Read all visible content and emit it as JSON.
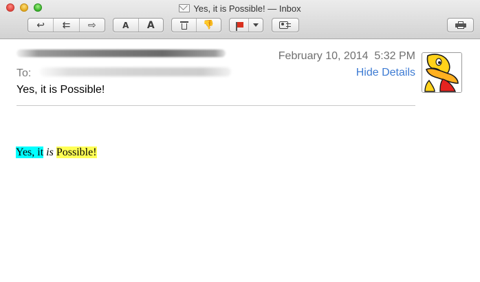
{
  "window": {
    "title": "Yes, it is Possible! — Inbox",
    "title_icon": "envelope-icon"
  },
  "toolbar": {
    "groups": [
      {
        "name": "reply-group",
        "buttons": [
          {
            "name": "reply-button",
            "icon": "reply-icon",
            "glyph": "↩"
          },
          {
            "name": "reply-all-button",
            "icon": "reply-all-icon",
            "glyph": "⇇"
          },
          {
            "name": "forward-button",
            "icon": "forward-icon",
            "glyph": "⇨"
          }
        ]
      },
      {
        "name": "font-size-group",
        "buttons": [
          {
            "name": "smaller-font-button",
            "label": "A"
          },
          {
            "name": "larger-font-button",
            "label": "A"
          }
        ]
      },
      {
        "name": "delete-junk-group",
        "buttons": [
          {
            "name": "delete-button",
            "icon": "trash-icon"
          },
          {
            "name": "junk-button",
            "icon": "thumbs-down-icon",
            "glyph": "👎"
          }
        ]
      }
    ],
    "flag": {
      "icon": "flag-icon",
      "color": "#d9301e"
    },
    "contact_icon": "add-contact-icon",
    "print_icon": "printer-icon"
  },
  "header": {
    "to_label": "To:",
    "subject": "Yes, it is Possible!",
    "date": "February 10, 2014  5:32 PM",
    "hide_details": "Hide Details",
    "link_color": "#3d7bd3"
  },
  "body": {
    "part1": "Yes, it",
    "part2": " ",
    "part3": "is",
    "part4": " ",
    "part5": "Possible!",
    "highlight_colors": {
      "cyan": "#00ffff",
      "yellow": "#ffff55"
    }
  }
}
